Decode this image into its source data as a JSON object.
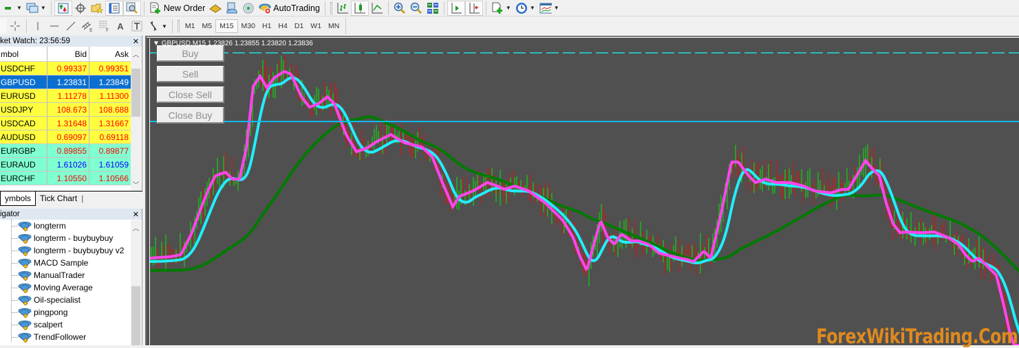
{
  "toolbar_main": {
    "new_order_label": "New Order",
    "autotrading_label": "AutoTrading",
    "icons": [
      "new-chart-icon",
      "profiles-icon",
      "market-watch-icon",
      "data-window-icon",
      "navigator-icon",
      "terminal-icon",
      "strategy-tester-icon",
      "new-order-icon",
      "metaeditor-icon",
      "signals-icon",
      "market-icon",
      "autotrading-icon",
      "bar-chart-icon",
      "candlestick-icon",
      "line-chart-icon",
      "zoom-in-icon",
      "zoom-out-icon",
      "tile-windows-icon",
      "auto-scroll-icon",
      "chart-shift-icon",
      "indicators-icon",
      "periods-icon",
      "templates-icon"
    ]
  },
  "toolbar_draw": {
    "tools": [
      "cursor",
      "crosshair",
      "vertical-line",
      "horizontal-line",
      "trendline",
      "equidistant-channel",
      "fibonacci-retracement",
      "text",
      "text-label",
      "arrows"
    ],
    "text_tool_label": "A",
    "timeframes": [
      "M1",
      "M5",
      "M15",
      "M30",
      "H1",
      "H4",
      "D1",
      "W1",
      "MN"
    ],
    "active_timeframe": "M15"
  },
  "market_watch": {
    "title": "ket Watch: 23:56:59",
    "columns": {
      "symbol": "mbol",
      "bid": "Bid",
      "ask": "Ask"
    },
    "rows": [
      {
        "symbol": "USDCHF",
        "bid": "0.99337",
        "ask": "0.99351",
        "bg": "#ffff40",
        "color": "#ff0000",
        "selected": false
      },
      {
        "symbol": "GBPUSD",
        "bid": "1.23831",
        "ask": "1.23849",
        "bg": "#0a6fd1",
        "color": "#ffffff",
        "selected": true
      },
      {
        "symbol": "EURUSD",
        "bid": "1.11278",
        "ask": "1.11300",
        "bg": "#ffff40",
        "color": "#ff0000",
        "selected": false
      },
      {
        "symbol": "USDJPY",
        "bid": "108.673",
        "ask": "108.688",
        "bg": "#ffff40",
        "color": "#ff0000",
        "selected": false
      },
      {
        "symbol": "USDCAD",
        "bid": "1.31648",
        "ask": "1.31667",
        "bg": "#ffff40",
        "color": "#ff0000",
        "selected": false
      },
      {
        "symbol": "AUDUSD",
        "bid": "0.69097",
        "ask": "0.69118",
        "bg": "#ffff40",
        "color": "#ff0000",
        "selected": false
      },
      {
        "symbol": "EURGBP",
        "bid": "0.89855",
        "ask": "0.89877",
        "bg": "#80ffd0",
        "color": "#ff0000",
        "selected": false
      },
      {
        "symbol": "EURAUD",
        "bid": "1.61026",
        "ask": "1.61059",
        "bg": "#80ffd0",
        "color": "#0000ff",
        "selected": false
      },
      {
        "symbol": "EURCHF",
        "bid": "1.10550",
        "ask": "1.10566",
        "bg": "#80ffd0",
        "color": "#ff0000",
        "selected": false
      }
    ],
    "tabs": [
      {
        "label": "ymbols",
        "active": true
      },
      {
        "label": "Tick Chart",
        "active": false
      }
    ]
  },
  "navigator": {
    "title": "igator",
    "items": [
      "longterm",
      "longterm - buybuybuy",
      "longterm - buybuybuy v2",
      "MACD Sample",
      "ManualTrader",
      "Moving Average",
      "Oil-specialist",
      "pingpong",
      "scalpert",
      "TrendFollower"
    ]
  },
  "chart": {
    "header": "GBPUSD,M15  1.23826 1.23855 1.23820 1.23836",
    "buttons": [
      "Buy",
      "Sell",
      "Close Sell",
      "Close Buy"
    ],
    "watermark": "ForexWikiTrading.Com",
    "colors": {
      "background": "#505050",
      "bull_bar": "#00ee00",
      "bear_bar": "#dd1111",
      "fast_ma": "#ff44ee",
      "mid_ma": "#22eeff",
      "slow_ma": "#007a00",
      "level_line": "#11bbee",
      "dashed_line": "#22dddd"
    }
  }
}
